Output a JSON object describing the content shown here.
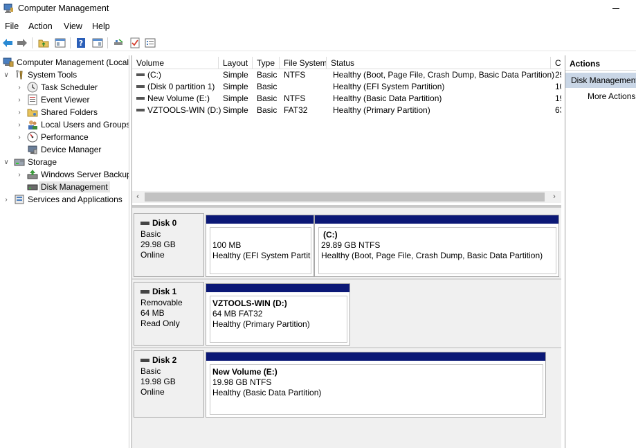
{
  "window": {
    "title": "Computer Management"
  },
  "menu": {
    "file": "File",
    "action": "Action",
    "view": "View",
    "help": "Help"
  },
  "tree": {
    "root": "Computer Management (Local",
    "system_tools": "System Tools",
    "task_scheduler": "Task Scheduler",
    "event_viewer": "Event Viewer",
    "shared_folders": "Shared Folders",
    "local_users": "Local Users and Groups",
    "performance": "Performance",
    "device_manager": "Device Manager",
    "storage": "Storage",
    "backup": "Windows Server Backup",
    "disk_management": "Disk Management",
    "services": "Services and Applications"
  },
  "volumes": {
    "headers": {
      "volume": "Volume",
      "layout": "Layout",
      "type": "Type",
      "fs": "File System",
      "status": "Status",
      "c": "C"
    },
    "rows": [
      {
        "volume": "(C:)",
        "layout": "Simple",
        "type": "Basic",
        "fs": "NTFS",
        "status": "Healthy (Boot, Page File, Crash Dump, Basic Data Partition)",
        "cap": "29"
      },
      {
        "volume": "(Disk 0 partition 1)",
        "layout": "Simple",
        "type": "Basic",
        "fs": "",
        "status": "Healthy (EFI System Partition)",
        "cap": "10"
      },
      {
        "volume": "New Volume (E:)",
        "layout": "Simple",
        "type": "Basic",
        "fs": "NTFS",
        "status": "Healthy (Basic Data Partition)",
        "cap": "19"
      },
      {
        "volume": "VZTOOLS-WIN (D:)",
        "layout": "Simple",
        "type": "Basic",
        "fs": "FAT32",
        "status": "Healthy (Primary Partition)",
        "cap": "63"
      }
    ]
  },
  "disks": [
    {
      "name": "Disk 0",
      "type": "Basic",
      "size": "29.98 GB",
      "state": "Online",
      "partitions": [
        {
          "name": "",
          "detail": "100 MB",
          "status": "Healthy (EFI System Partition)"
        },
        {
          "name": "(C:)",
          "detail": "29.89 GB NTFS",
          "status": "Healthy (Boot, Page File, Crash Dump, Basic Data Partition)"
        }
      ]
    },
    {
      "name": "Disk 1",
      "type": "Removable",
      "size": "64 MB",
      "state": "Read Only",
      "partitions": [
        {
          "name": "VZTOOLS-WIN  (D:)",
          "detail": "64 MB FAT32",
          "status": "Healthy (Primary Partition)"
        }
      ]
    },
    {
      "name": "Disk 2",
      "type": "Basic",
      "size": "19.98 GB",
      "state": "Online",
      "partitions": [
        {
          "name": "New Volume  (E:)",
          "detail": "19.98 GB NTFS",
          "status": "Healthy (Basic Data Partition)"
        }
      ]
    }
  ],
  "actions": {
    "header": "Actions",
    "selected": "Disk Management",
    "more": "More Actions"
  },
  "colors": {
    "partition_bar": "#0b1876",
    "selection": "#c9d6e6"
  }
}
